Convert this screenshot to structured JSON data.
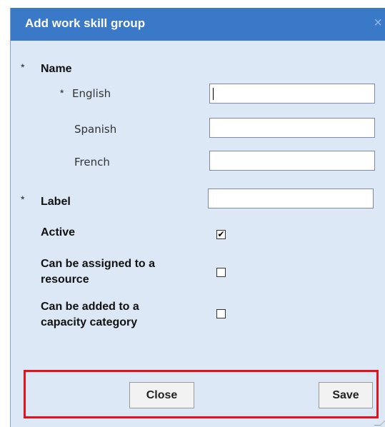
{
  "dialog": {
    "title": "Add work skill group",
    "close_glyph": "×"
  },
  "form": {
    "required_marker": "*",
    "name_label": "Name",
    "english_label": "English",
    "spanish_label": "Spanish",
    "french_label": "French",
    "label_label": "Label",
    "active_label": "Active",
    "assignable_label_line1": "Can be assigned to a",
    "assignable_label_line2": "resource",
    "capacity_label_line1": "Can be added to a",
    "capacity_label_line2": "capacity category",
    "english_value": "",
    "spanish_value": "",
    "french_value": "",
    "label_value": "",
    "active_checked": true,
    "assignable_checked": false,
    "capacity_checked": false,
    "check_glyph": "✔"
  },
  "footer": {
    "close_label": "Close",
    "save_label": "Save",
    "highlight_color": "#e8101a"
  },
  "colors": {
    "titlebar": "#3a78c8",
    "dialog_bg": "#dde8f7"
  }
}
